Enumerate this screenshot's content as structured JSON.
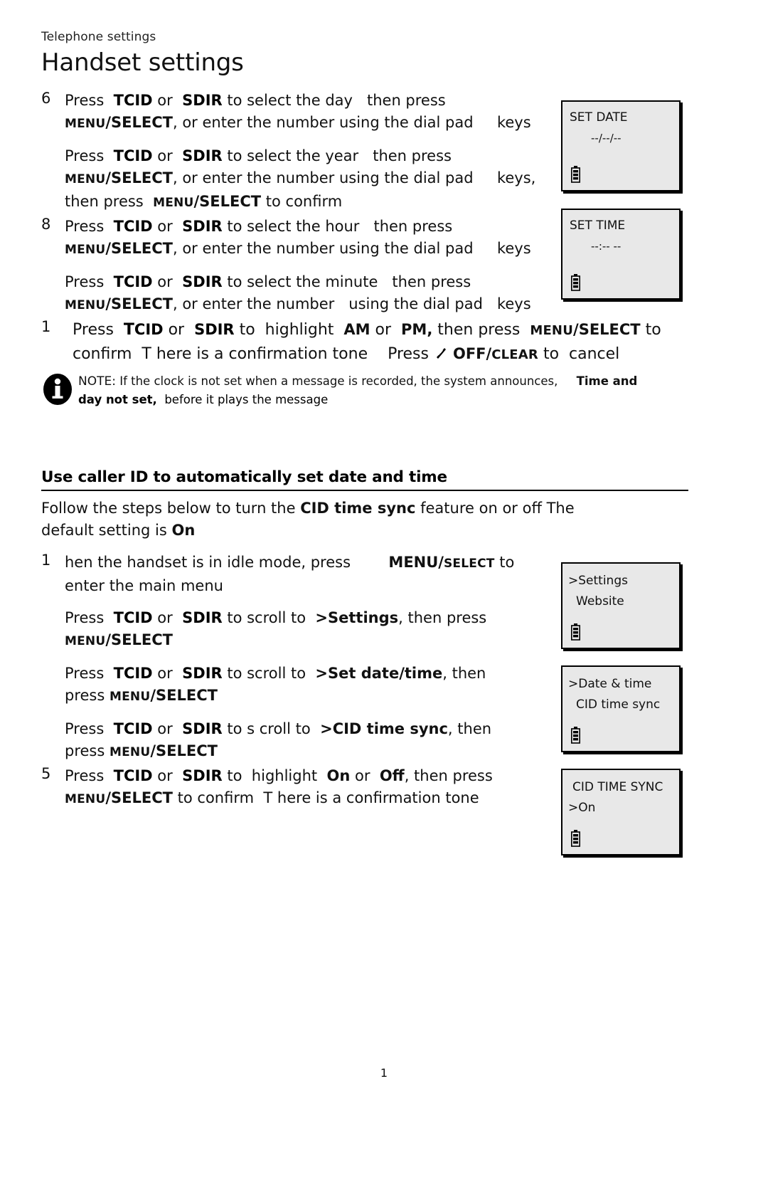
{
  "header": {
    "eyebrow": "Telephone settings",
    "title": "Handset settings"
  },
  "steps_top": [
    {
      "num": "6",
      "lines": [
        "Press  TCID or  SDIR to select the day   then press",
        "MENU/SELECT, or enter the number using the dial pad     keys"
      ]
    },
    {
      "num": "",
      "lines": [
        "Press  TCID or  SDIR to select the year   then press",
        "MENU/SELECT, or enter the number using the dial pad     keys,",
        "then press  MENU/SELECT to confirm"
      ]
    },
    {
      "num": "8",
      "lines": [
        "Press  TCID or  SDIR to select the hour   then press",
        "MENU/SELECT, or enter the number using the dial pad     keys"
      ]
    },
    {
      "num": "",
      "lines": [
        "Press  TCID or  SDIR to select the minute   then press",
        "MENU/SELECT, or enter the number   using the dial pad   keys"
      ]
    },
    {
      "num": "1",
      "lines": [
        "Press  TCID or  SDIR to  highlight  AM or  PM, then press  MENU/SELECT to",
        "confirm  T here is a confirmation tone    Press  OFF/CLEAR  to  cancel"
      ]
    }
  ],
  "note": {
    "label": "NOTE:",
    "text_1": "If the clock is not set when a message is recorded, the system announces,",
    "emph_1": "Time and",
    "emph_2": "day not set,",
    "text_2": "before it plays the message"
  },
  "section": {
    "heading": "Use caller ID to automatically set date and time",
    "intro_line_1_a": "Follow the steps below to    turn the  ",
    "intro_line_1_b": "CID time sync",
    "intro_line_1_c": " feature on or off The",
    "intro_line_2_a": "default setting is  ",
    "intro_line_2_b": "On"
  },
  "steps_bottom": [
    {
      "num": "1",
      "lines": [
        "hen the handset is in idle mode, press         MENU/SELECT to",
        "enter the main menu"
      ]
    },
    {
      "num": "",
      "lines": [
        "Press  TCID or  SDIR to scroll to  >Settings, then press",
        "MENU/SELECT"
      ]
    },
    {
      "num": "",
      "lines": [
        "Press  TCID or  SDIR to scroll to  >Set date/time, then",
        "press MENU/SELECT"
      ]
    },
    {
      "num": "",
      "lines": [
        "Press  TCID or  SDIR to s croll to  >CID time sync, then",
        "press MENU/SELECT"
      ]
    },
    {
      "num": "5",
      "lines": [
        "Press  TCID or  SDIR to  highlight  On or  Off, then press",
        "MENU/SELECT to confirm  T here is a confirmation tone"
      ]
    }
  ],
  "lcds": [
    {
      "name": "set-date",
      "line1": "SET DATE",
      "line2": "--/--/--",
      "battery": "battery-icon"
    },
    {
      "name": "set-time",
      "line1": "SET TIME",
      "line2": "--:-- --",
      "battery": "battery-icon"
    },
    {
      "name": "settings-menu",
      "line1": ">Settings",
      "line2": "Website",
      "battery": "battery-icon"
    },
    {
      "name": "date-time-menu",
      "line1": ">Date & time",
      "line2": "CID time sync",
      "battery": "battery-icon"
    },
    {
      "name": "cid-time-sync",
      "line1": "CID TIME SYNC",
      "line2": ">On",
      "battery": "battery-icon"
    }
  ],
  "page_number": "1",
  "colors": {
    "lcd_fill": "#e8e8e8",
    "lcd_border": "#000000",
    "text": "#111111"
  }
}
